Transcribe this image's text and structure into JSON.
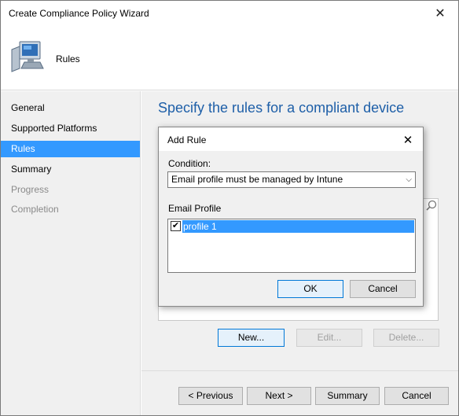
{
  "window": {
    "title": "Create Compliance Policy Wizard",
    "close_glyph": "✕"
  },
  "header": {
    "page_name": "Rules",
    "icon": "computer-icon"
  },
  "sidebar": {
    "items": [
      {
        "label": "General",
        "state": "normal"
      },
      {
        "label": "Supported Platforms",
        "state": "normal"
      },
      {
        "label": "Rules",
        "state": "active"
      },
      {
        "label": "Summary",
        "state": "normal"
      },
      {
        "label": "Progress",
        "state": "disabled"
      },
      {
        "label": "Completion",
        "state": "disabled"
      }
    ]
  },
  "main": {
    "heading": "Specify the rules for a compliant device",
    "search_icon": "magnifier-icon",
    "buttons": {
      "new": "New...",
      "edit": "Edit...",
      "delete": "Delete..."
    }
  },
  "footer": {
    "previous": "< Previous",
    "next": "Next >",
    "summary": "Summary",
    "cancel": "Cancel"
  },
  "dialog": {
    "title": "Add Rule",
    "close_glyph": "✕",
    "condition_label": "Condition:",
    "condition_value": "Email profile must be managed by Intune",
    "email_profile_label": "Email Profile",
    "profiles": [
      {
        "label": "profile 1",
        "checked": true
      }
    ],
    "ok": "OK",
    "cancel": "Cancel"
  },
  "colors": {
    "accent": "#3399ff",
    "heading": "#1e5fa8",
    "panel": "#f0f0f0"
  }
}
